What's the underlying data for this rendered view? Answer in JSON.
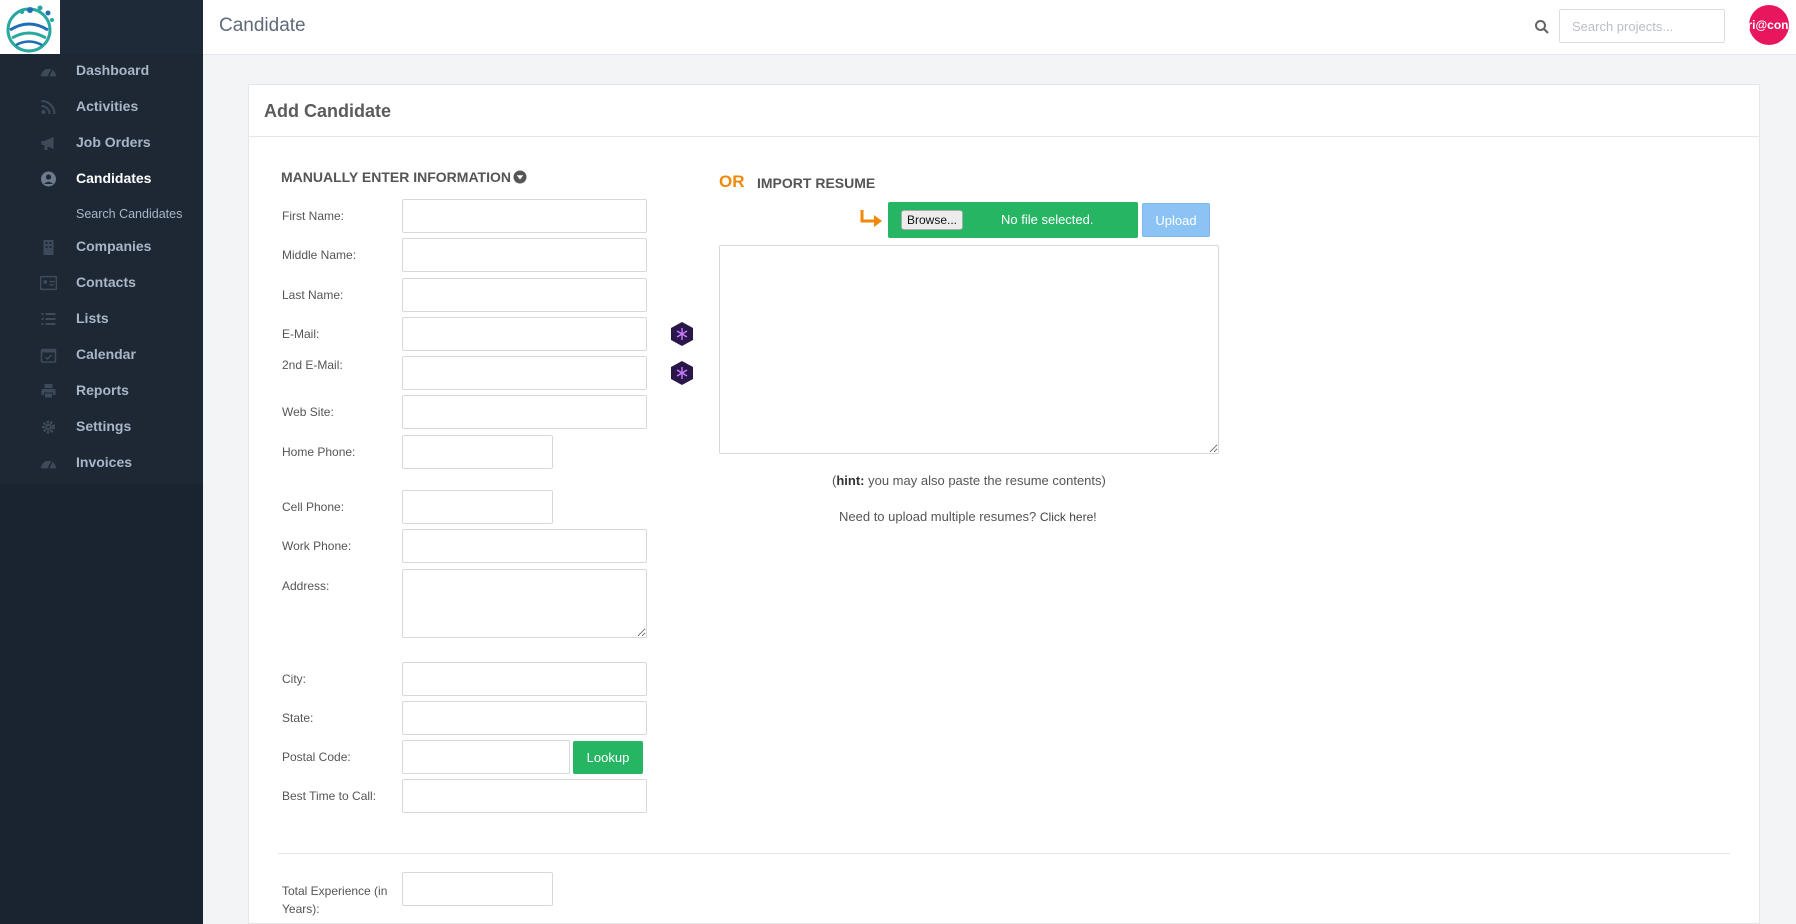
{
  "header": {
    "title": "Candidate",
    "search_placeholder": "Search projects...",
    "avatar_text": "ri@con"
  },
  "sidebar": {
    "items": [
      {
        "label": "Dashboard",
        "icon": "dashboard-icon"
      },
      {
        "label": "Activities",
        "icon": "rss-icon"
      },
      {
        "label": "Job Orders",
        "icon": "megaphone-icon"
      },
      {
        "label": "Candidates",
        "icon": "user-circle-icon",
        "active": true
      },
      {
        "label": "Companies",
        "icon": "building-icon"
      },
      {
        "label": "Contacts",
        "icon": "contact-card-icon"
      },
      {
        "label": "Lists",
        "icon": "list-icon"
      },
      {
        "label": "Calendar",
        "icon": "calendar-icon"
      },
      {
        "label": "Reports",
        "icon": "printer-icon"
      },
      {
        "label": "Settings",
        "icon": "gear-icon"
      },
      {
        "label": "Invoices",
        "icon": "dashboard-icon"
      }
    ],
    "subitem": "Search Candidates"
  },
  "panel": {
    "title": "Add Candidate"
  },
  "manual": {
    "heading": "MANUALLY ENTER INFORMATION",
    "labels": {
      "first_name": "First Name:",
      "middle_name": "Middle Name:",
      "last_name": "Last Name:",
      "email": "E-Mail:",
      "email2": "2nd E-Mail:",
      "website": "Web Site:",
      "home_phone": "Home Phone:",
      "cell_phone": "Cell Phone:",
      "work_phone": "Work Phone:",
      "address": "Address:",
      "city": "City:",
      "state": "State:",
      "postal_code": "Postal Code:",
      "best_time": "Best Time to Call:",
      "total_exp_line1": "Total Experience (in",
      "total_exp_line2": "Years):"
    },
    "lookup_label": "Lookup"
  },
  "import": {
    "or_text": "OR",
    "heading": "IMPORT RESUME",
    "browse_label": "Browse...",
    "file_status": "No file selected.",
    "upload_label": "Upload",
    "hint_bold": "hint:",
    "hint_text": " you may also paste the resume contents)",
    "hint_open": "(",
    "multi_text": "Need to upload multiple resumes? ",
    "multi_link": "Click here!"
  },
  "colors": {
    "sidebar_bg": "#1a2330",
    "accent_green": "#26b562",
    "accent_orange": "#f0880a",
    "upload_blue": "#8cc3f5",
    "avatar_pink": "#e8175d"
  }
}
